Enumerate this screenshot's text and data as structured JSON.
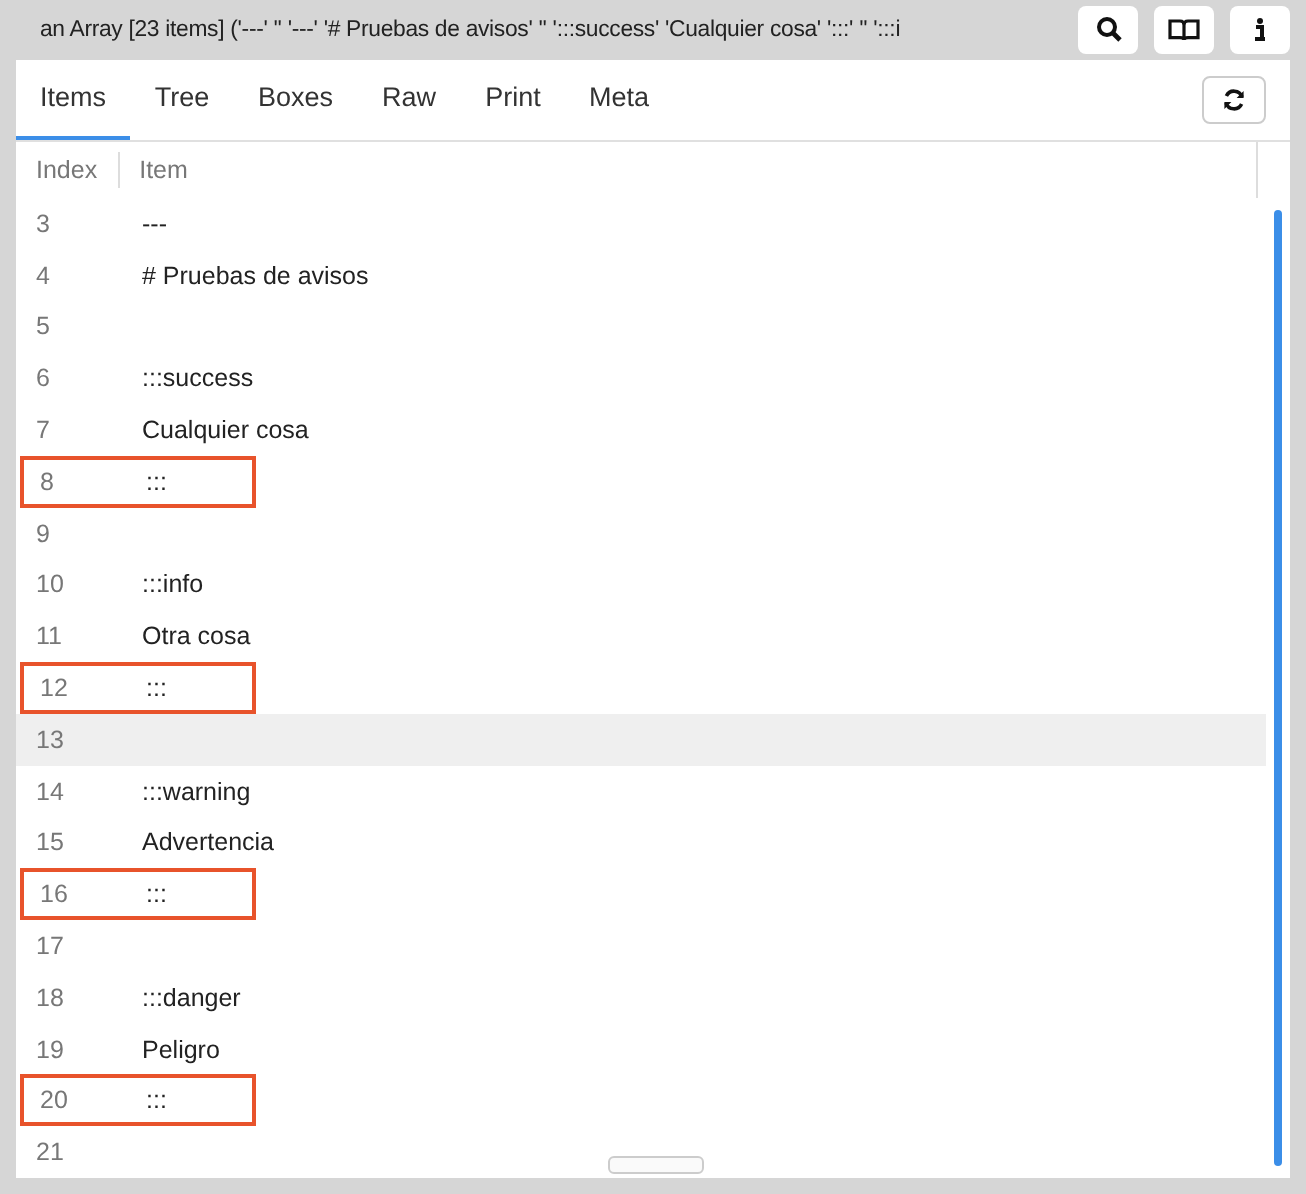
{
  "window": {
    "title": "an Array [23 items] ('---' '' '---' '# Pruebas de avisos' '' ':::success' 'Cualquier cosa' ':::' '' ':::i"
  },
  "tabs": [
    {
      "label": "Items",
      "selected": true
    },
    {
      "label": "Tree",
      "selected": false
    },
    {
      "label": "Boxes",
      "selected": false
    },
    {
      "label": "Raw",
      "selected": false
    },
    {
      "label": "Print",
      "selected": false
    },
    {
      "label": "Meta",
      "selected": false
    }
  ],
  "table": {
    "columns": [
      "Index",
      "Item"
    ],
    "rows": [
      {
        "index": "3",
        "item": "---",
        "highlighted": false,
        "hovered": false
      },
      {
        "index": "4",
        "item": "# Pruebas de avisos",
        "highlighted": false,
        "hovered": false
      },
      {
        "index": "5",
        "highlighted": false,
        "hovered": false
      },
      {
        "index": "6",
        "item": ":::success",
        "highlighted": false,
        "hovered": false
      },
      {
        "index": "7",
        "item": "Cualquier cosa",
        "highlighted": false,
        "hovered": false
      },
      {
        "index": "8",
        "item": ":::",
        "highlighted": true,
        "hovered": false
      },
      {
        "index": "9",
        "highlighted": false,
        "hovered": false
      },
      {
        "index": "10",
        "item": ":::info",
        "highlighted": false,
        "hovered": false
      },
      {
        "index": "11",
        "item": "Otra cosa",
        "highlighted": false,
        "hovered": false
      },
      {
        "index": "12",
        "item": ":::",
        "highlighted": true,
        "hovered": false
      },
      {
        "index": "13",
        "highlighted": false,
        "hovered": true
      },
      {
        "index": "14",
        "item": ":::warning",
        "highlighted": false,
        "hovered": false
      },
      {
        "index": "15",
        "item": "Advertencia",
        "highlighted": false,
        "hovered": false
      },
      {
        "index": "16",
        "item": ":::",
        "highlighted": true,
        "hovered": false
      },
      {
        "index": "17",
        "highlighted": false,
        "hovered": false
      },
      {
        "index": "18",
        "item": ":::danger",
        "highlighted": false,
        "hovered": false
      },
      {
        "index": "19",
        "item": "Peligro",
        "highlighted": false,
        "hovered": false
      },
      {
        "index": "20",
        "item": ":::",
        "highlighted": true,
        "hovered": false
      },
      {
        "index": "21",
        "highlighted": false,
        "hovered": false
      }
    ]
  }
}
